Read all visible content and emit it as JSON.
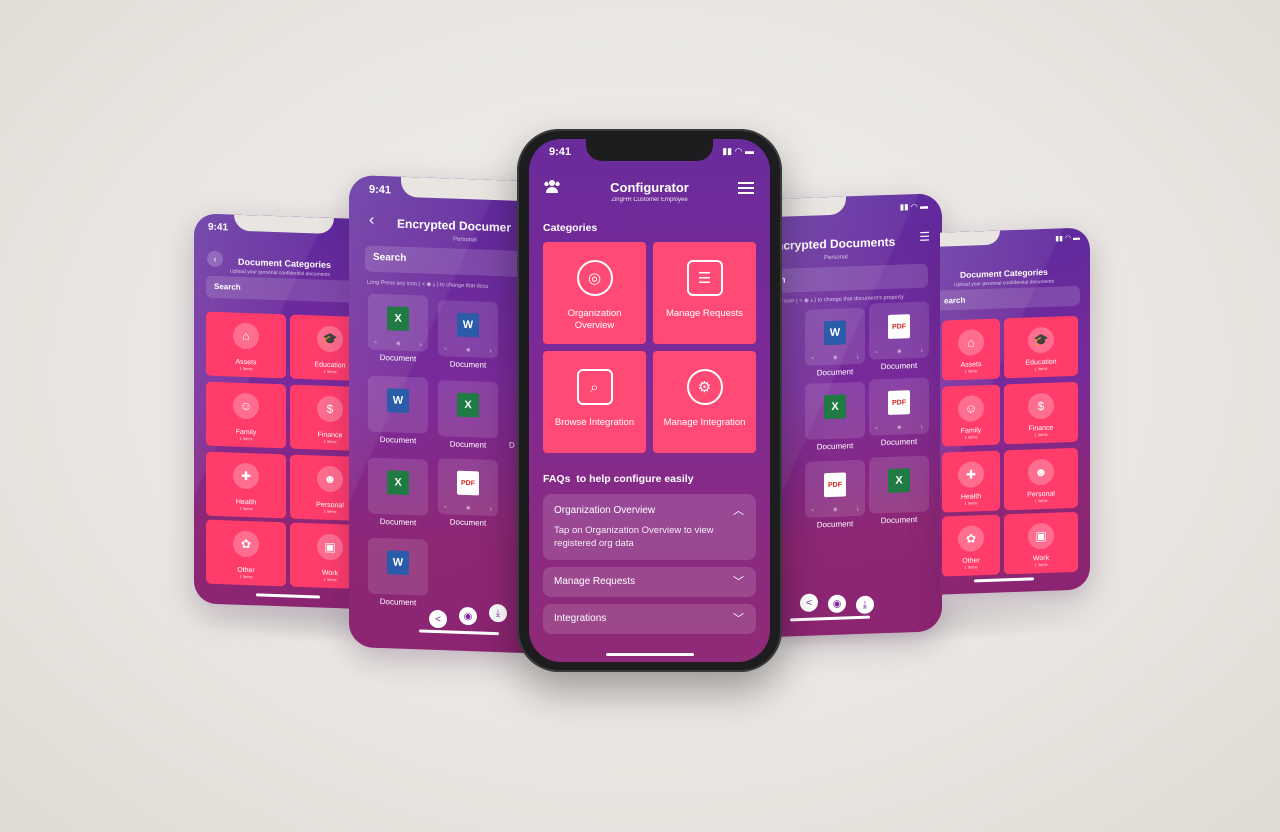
{
  "main": {
    "time": "9:41",
    "title": "Configurator",
    "subtitle": "ZingHR Customer Employee",
    "categories_heading": "Categories",
    "categories": [
      {
        "label": "Organization Overview",
        "icon": "org-icon"
      },
      {
        "label": "Manage Requests",
        "icon": "chat-icon"
      },
      {
        "label": "Browse Integration",
        "icon": "browse-icon"
      },
      {
        "label": "Manage Integration",
        "icon": "gear-icon"
      }
    ],
    "faq_heading": "FAQs  to help configure easily",
    "faqs": [
      {
        "question": "Organization Overview",
        "answer": "Tap on Organization Overview to view registered org data"
      },
      {
        "question": "Manage Requests"
      },
      {
        "question": "Integrations"
      }
    ]
  },
  "left_outer": {
    "time": "9:41",
    "title": "Document Categories",
    "subtitle": "Upload your personal confidential documents",
    "search": "Search",
    "items": [
      {
        "name": "Assets",
        "count": "1 Items"
      },
      {
        "name": "Education",
        "count": "1 Items"
      },
      {
        "name": "Family",
        "count": "1 Items"
      },
      {
        "name": "Finance",
        "count": "1 Items"
      },
      {
        "name": "Health",
        "count": "1 Items"
      },
      {
        "name": "Personal",
        "count": "1 Items"
      },
      {
        "name": "Other",
        "count": "1 Items"
      },
      {
        "name": "Work",
        "count": "1 Items"
      }
    ]
  },
  "left_inner": {
    "time": "9:41",
    "title": "Encrypted Documer",
    "subtitle": "Personal",
    "search": "Search",
    "hint": "Long Press any icon ( < ◉ ⤓ ) to change that docu",
    "doc_label": "Document",
    "partial_label": "D"
  },
  "right_inner": {
    "title": "ncrypted Documents",
    "subtitle": "Personal",
    "search": "h",
    "hint": "y icon ( < ◉ ⤓ ) to change that document's property",
    "doc_label": "Document"
  },
  "right_outer": {
    "title": "Document Categories",
    "subtitle": "Upload your personal confidential documents",
    "search": "earch",
    "items": [
      {
        "name": "Assets",
        "count": "1 Items"
      },
      {
        "name": "Education",
        "count": "1 Items"
      },
      {
        "name": "Family",
        "count": "1 Items"
      },
      {
        "name": "Finance",
        "count": "1 Items"
      },
      {
        "name": "Health",
        "count": "1 Items"
      },
      {
        "name": "Personal",
        "count": "1 Items"
      },
      {
        "name": "Other",
        "count": "1 Items"
      },
      {
        "name": "Work",
        "count": "1 Items"
      }
    ]
  },
  "colors": {
    "tile_pink": "#ff4a75",
    "purple": "#6a2b9a",
    "magenta": "#8f2a76"
  }
}
